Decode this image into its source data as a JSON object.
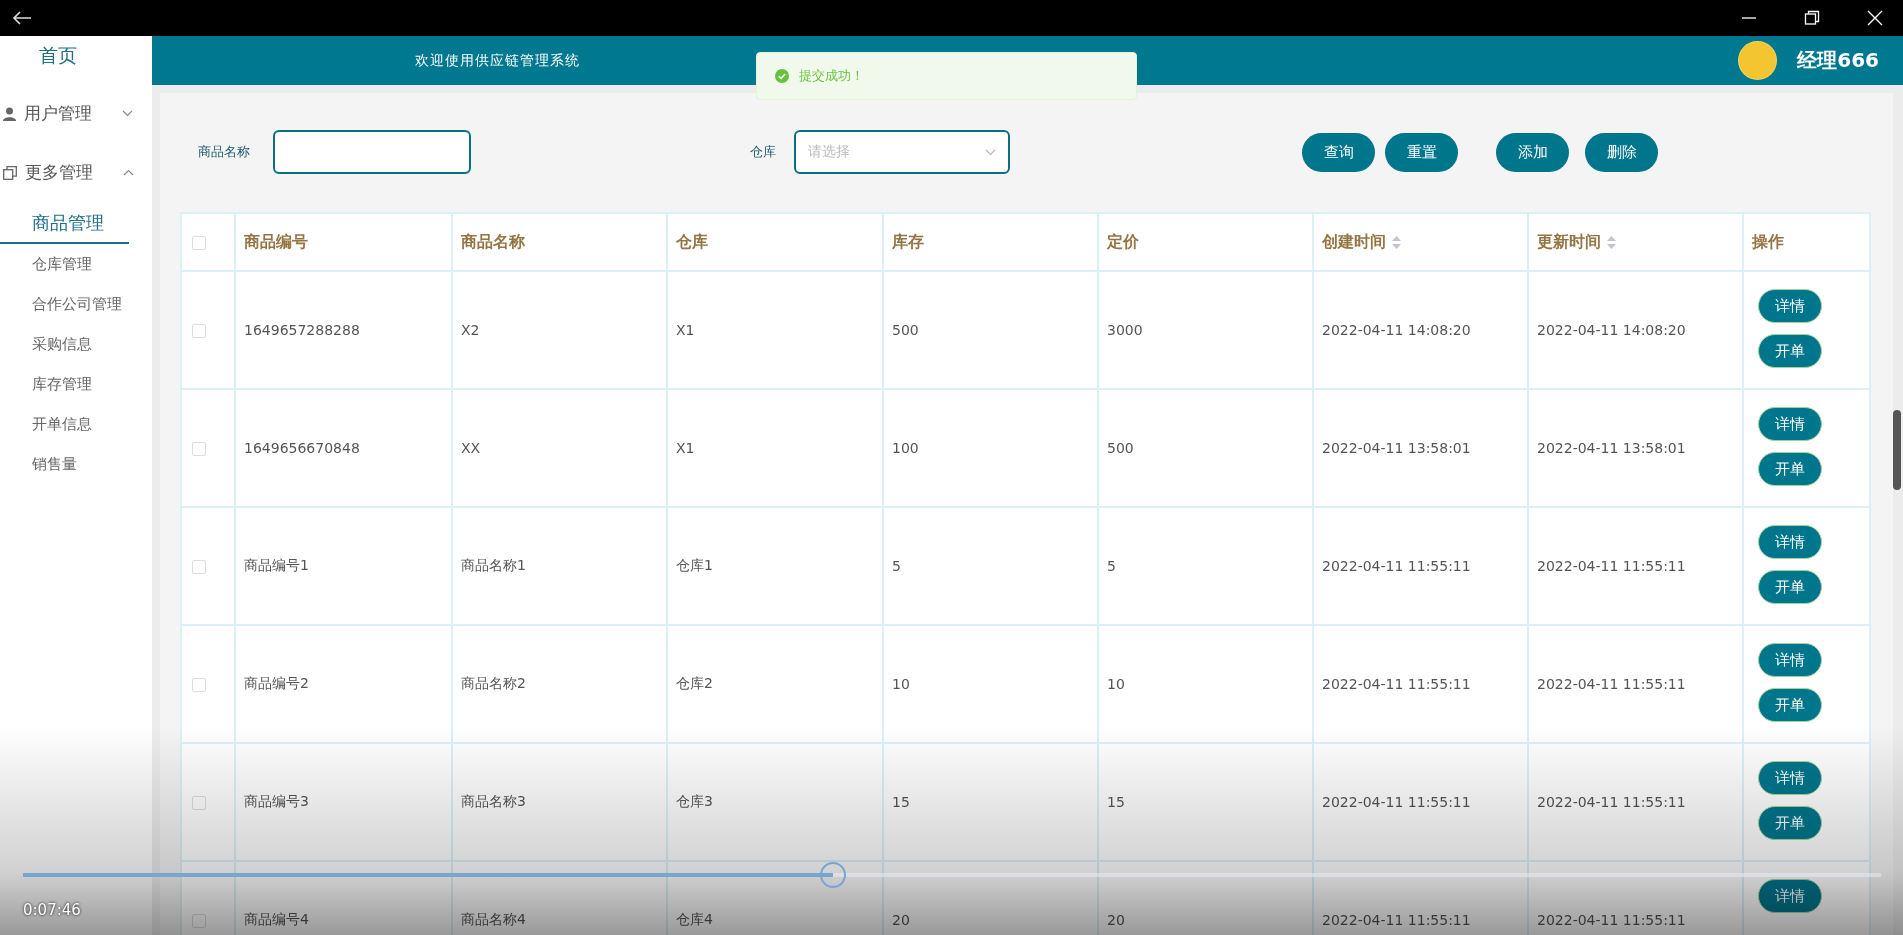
{
  "header": {
    "title": "欢迎使用供应链管理系统",
    "user": "经理666"
  },
  "toast": {
    "message": "提交成功！"
  },
  "sidebar": {
    "home": "首页",
    "groups": [
      {
        "label": "用户管理",
        "kind": "user",
        "expanded": false
      },
      {
        "label": "更多管理",
        "kind": "copy",
        "expanded": true,
        "children": [
          {
            "label": "商品管理",
            "selected": true
          },
          {
            "label": "仓库管理",
            "selected": false
          },
          {
            "label": "合作公司管理",
            "selected": false
          },
          {
            "label": "采购信息",
            "selected": false
          },
          {
            "label": "库存管理",
            "selected": false
          },
          {
            "label": "开单信息",
            "selected": false
          },
          {
            "label": "销售量",
            "selected": false
          }
        ]
      }
    ]
  },
  "filters": [
    {
      "label": "商品名称",
      "kind": "input"
    },
    {
      "label": "仓库",
      "kind": "select",
      "placeholder": "请选择"
    }
  ],
  "buttons": [
    {
      "label": "查询"
    },
    {
      "label": "重置"
    },
    {
      "label": "添加"
    },
    {
      "label": "删除"
    }
  ],
  "table": {
    "all_checked": false,
    "columns": [
      {
        "label": "商品编号",
        "sortable": false
      },
      {
        "label": "商品名称",
        "sortable": false
      },
      {
        "label": "仓库",
        "sortable": false
      },
      {
        "label": "库存",
        "sortable": false
      },
      {
        "label": "定价",
        "sortable": false
      },
      {
        "label": "创建时间",
        "sortable": true
      },
      {
        "label": "更新时间",
        "sortable": true
      },
      {
        "label": "操作",
        "sortable": false
      }
    ],
    "rows": [
      {
        "checked": false,
        "cells": [
          "1649657288288",
          "X2",
          "X1",
          "500",
          "3000",
          "2022-04-11 14:08:20",
          "2022-04-11 14:08:20"
        ],
        "actions": [
          "详情",
          "开单"
        ]
      },
      {
        "checked": false,
        "cells": [
          "1649656670848",
          "XX",
          "X1",
          "100",
          "500",
          "2022-04-11 13:58:01",
          "2022-04-11 13:58:01"
        ],
        "actions": [
          "详情",
          "开单"
        ]
      },
      {
        "checked": false,
        "cells": [
          "商品编号1",
          "商品名称1",
          "仓库1",
          "5",
          "5",
          "2022-04-11 11:55:11",
          "2022-04-11 11:55:11"
        ],
        "actions": [
          "详情",
          "开单"
        ]
      },
      {
        "checked": false,
        "cells": [
          "商品编号2",
          "商品名称2",
          "仓库2",
          "10",
          "10",
          "2022-04-11 11:55:11",
          "2022-04-11 11:55:11"
        ],
        "actions": [
          "详情",
          "开单"
        ]
      },
      {
        "checked": false,
        "cells": [
          "商品编号3",
          "商品名称3",
          "仓库3",
          "15",
          "15",
          "2022-04-11 11:55:11",
          "2022-04-11 11:55:11"
        ],
        "actions": [
          "详情",
          "开单"
        ]
      },
      {
        "checked": false,
        "cells": [
          "商品编号4",
          "商品名称4",
          "仓库4",
          "20",
          "20",
          "2022-04-11 11:55:11",
          "2022-04-11 11:55:11"
        ],
        "actions": [
          "详情"
        ]
      }
    ]
  },
  "player": {
    "time": "0:07:46",
    "level": 0.436
  }
}
